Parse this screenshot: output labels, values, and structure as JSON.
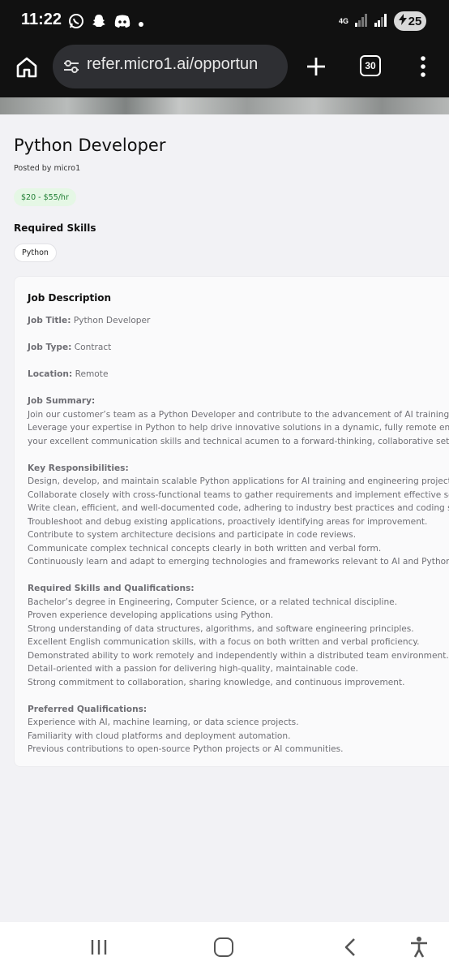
{
  "status_bar": {
    "time": "11:22",
    "app_icons": [
      "whatsapp-icon",
      "snapchat-icon",
      "discord-icon",
      "dot-icon"
    ],
    "network_label": "4G",
    "battery": "25"
  },
  "browser": {
    "url": "refer.micro1.ai/opportun",
    "tab_count": "30"
  },
  "job": {
    "title": "Python Developer",
    "posted_by": "Posted by micro1",
    "rate": "$20 - $55/hr",
    "skills_heading": "Required Skills",
    "skills": [
      "Python"
    ],
    "description_heading": "Job Description",
    "job_title_label": "Job Title:",
    "job_title_value": " Python Developer",
    "job_type_label": "Job Type:",
    "job_type_value": " Contract",
    "location_label": "Location:",
    "location_value": " Remote",
    "summary_heading": "Job Summary:",
    "summary_lines": [
      "Join our customer’s team as a Python Developer and contribute to the advancement of AI training initiatives",
      "Leverage your expertise in Python to help drive innovative solutions in a dynamic, fully remote environment. B",
      "your excellent communication skills and technical acumen to a forward-thinking, collaborative setting."
    ],
    "responsibilities_heading": "Key Responsibilities:",
    "responsibilities": [
      "Design, develop, and maintain scalable Python applications for AI training and engineering projects.",
      "Collaborate closely with cross-functional teams to gather requirements and implement effective solutions.",
      "Write clean, efficient, and well-documented code, adhering to industry best practices and coding standards.",
      "Troubleshoot and debug existing applications, proactively identifying areas for improvement.",
      "Contribute to system architecture decisions and participate in code reviews.",
      "Communicate complex technical concepts clearly in both written and verbal form.",
      "Continuously learn and adapt to emerging technologies and frameworks relevant to AI and Python developm"
    ],
    "qualifications_heading": "Required Skills and Qualifications:",
    "qualifications": [
      "Bachelor’s degree in Engineering, Computer Science, or a related technical discipline.",
      "Proven experience developing applications using Python.",
      "Strong understanding of data structures, algorithms, and software engineering principles.",
      "Excellent English communication skills, with a focus on both written and verbal proficiency.",
      "Demonstrated ability to work remotely and independently within a distributed team environment.",
      "Detail-oriented with a passion for delivering high-quality, maintainable code.",
      "Strong commitment to collaboration, sharing knowledge, and continuous improvement."
    ],
    "preferred_heading": "Preferred Qualifications:",
    "preferred": [
      "Experience with AI, machine learning, or data science projects.",
      "Familiarity with cloud platforms and deployment automation.",
      "Previous contributions to open-source Python projects or AI communities."
    ]
  },
  "nav": {
    "icons": [
      "recent-apps-icon",
      "home-icon",
      "back-icon",
      "accessibility-icon"
    ]
  },
  "colors": {
    "rate_badge_bg": "#e5f7e5",
    "rate_badge_text": "#1e7d32",
    "toolbar_bg": "#111111",
    "omnibox_bg": "#2e2f33"
  }
}
